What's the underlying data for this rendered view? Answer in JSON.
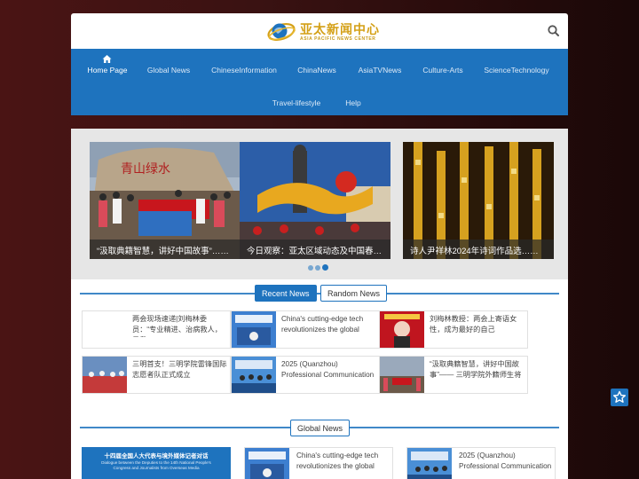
{
  "header": {
    "logo_cn": "亚太新闻中心",
    "logo_en": "ASIA PACIFIC NEWS CENTER",
    "search_icon": "search-icon"
  },
  "nav": {
    "items": [
      {
        "label": "Home Page",
        "active": true
      },
      {
        "label": "Global News"
      },
      {
        "label": "ChineseInformation"
      },
      {
        "label": "ChinaNews"
      },
      {
        "label": "AsiaTVNews"
      },
      {
        "label": "Culture-Arts"
      },
      {
        "label": "ScienceTechnology"
      },
      {
        "label": "Travel-lifestyle"
      },
      {
        "label": "Help"
      }
    ]
  },
  "slider": {
    "slides": [
      {
        "caption": "“汲取典籍智慧，讲好中国故事”……"
      },
      {
        "caption": "今日观察：亚太区域动态及中国春……"
      },
      {
        "caption": "诗人尹祥林2024年诗词作品选……"
      }
    ],
    "active_dot": 3
  },
  "tabs": {
    "recent": "Recent News",
    "random": "Random News"
  },
  "recent_cards": [
    {
      "text": "两会现场速递|刘梅林委员：“专业精进、治病救人，是我一"
    },
    {
      "text": "China's cutting-edge tech revolutionizes the global"
    },
    {
      "text": "刘梅林教授：两会上寄语女性，成为最好的自己"
    },
    {
      "text": "三明首支！三明学院雷锋国际志愿者队正式成立"
    },
    {
      "text": "2025 (Quanzhou) Professional Communication"
    },
    {
      "text": "“汲取典籍智慧，讲好中国故事”—— 三明学院外籍师生将"
    }
  ],
  "global": {
    "title": "Global News",
    "banner_cn": "十四届全国人大代表与境外媒体记者对话",
    "banner_en": "Dialogue between the Deputies to the 14th National People's Congress and Journalists from Overseas Media",
    "cards": [
      {
        "text": "China's cutting-edge tech revolutionizes the global"
      },
      {
        "text": "2025 (Quanzhou) Professional Communication"
      }
    ]
  },
  "colors": {
    "primary": "#1e73be",
    "logo_gold": "#d4a017"
  },
  "floating": {
    "icon": "star-icon"
  }
}
